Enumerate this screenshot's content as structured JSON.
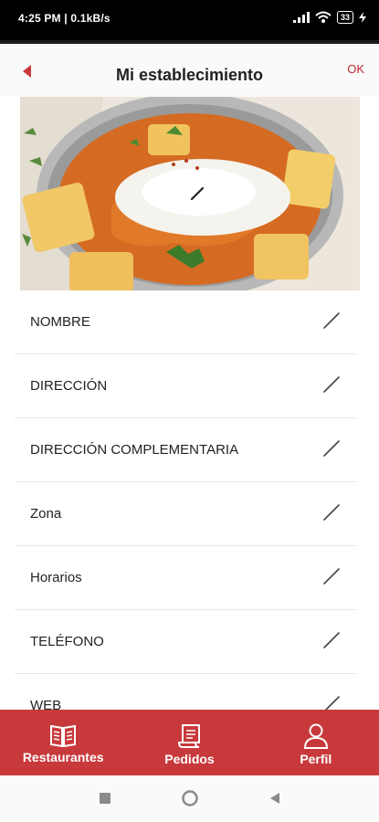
{
  "status": {
    "time_speed": "4:25 PM | 0.1kB/s",
    "battery": "33"
  },
  "header": {
    "title": "Mi establecimiento",
    "ok_label": "OK"
  },
  "colors": {
    "accent": "#c8393b",
    "ok_text": "#c1272d"
  },
  "fields": [
    {
      "label": "NOMBRE"
    },
    {
      "label": "DIRECCIÓN"
    },
    {
      "label": "DIRECCIÓN COMPLEMENTARIA"
    },
    {
      "label": "Zona"
    },
    {
      "label": "Horarios"
    },
    {
      "label": "TELÉFONO"
    },
    {
      "label": "WEB"
    }
  ],
  "nav": {
    "items": [
      {
        "label": "Restaurantes",
        "icon": "book-icon"
      },
      {
        "label": "Pedidos",
        "icon": "receipt-icon"
      },
      {
        "label": "Perfil",
        "icon": "person-icon"
      }
    ]
  },
  "system_nav": {
    "icons": [
      "square-icon",
      "circle-icon",
      "triangle-back-icon"
    ]
  }
}
